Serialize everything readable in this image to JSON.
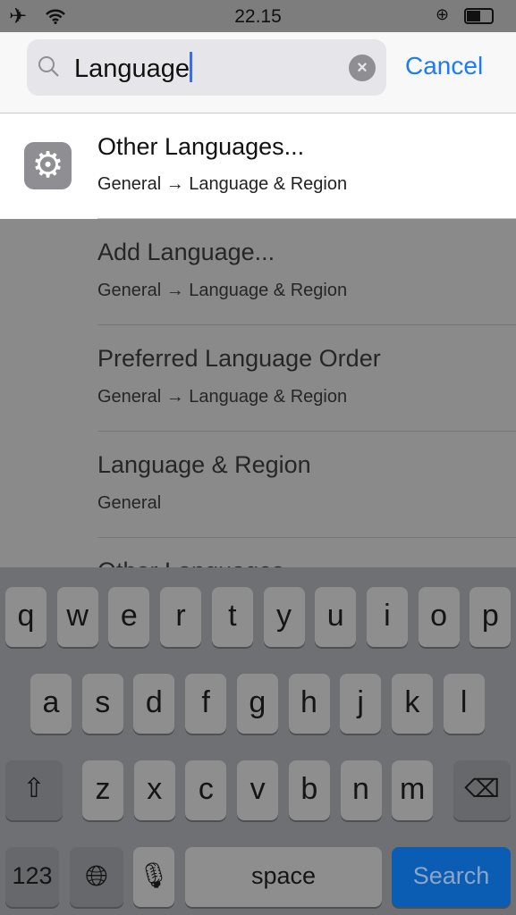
{
  "status_bar": {
    "time": "22.15",
    "icons": [
      "airplane-icon",
      "wifi-icon",
      "rotation-lock-icon",
      "battery-icon"
    ]
  },
  "search": {
    "value": "Language",
    "cancel_label": "Cancel"
  },
  "results": [
    {
      "title": "Other Languages...",
      "path": "General → Language & Region",
      "highlighted": true
    },
    {
      "title": "Add Language...",
      "path": "General → Language & Region"
    },
    {
      "title": "Preferred Language Order",
      "path": "General → Language & Region"
    },
    {
      "title": "Language & Region",
      "path": "General"
    },
    {
      "title": "Other Languages...",
      "path": ""
    }
  ],
  "keyboard": {
    "row1": [
      "q",
      "w",
      "e",
      "r",
      "t",
      "y",
      "u",
      "i",
      "o",
      "p"
    ],
    "row2": [
      "a",
      "s",
      "d",
      "f",
      "g",
      "h",
      "j",
      "k",
      "l"
    ],
    "row3": [
      "z",
      "x",
      "c",
      "v",
      "b",
      "n",
      "m"
    ],
    "numbers_label": "123",
    "space_label": "space",
    "search_label": "Search"
  },
  "colors": {
    "accent": "#1e7cf2",
    "search_key": "#0b5cb3"
  }
}
